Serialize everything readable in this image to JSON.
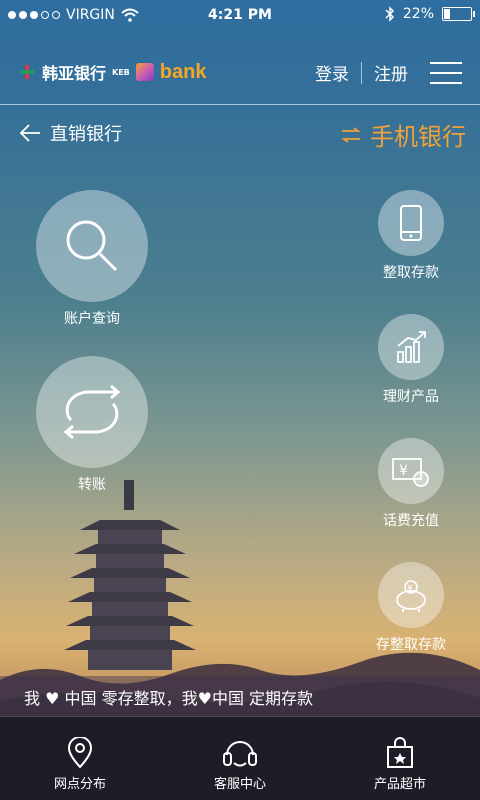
{
  "status_bar": {
    "carrier": "VIRGIN",
    "time": "4:21 PM",
    "battery": "22%"
  },
  "header": {
    "brand_cn": "韩亚银行",
    "brand_sub": "KEB",
    "brand_en": "bank",
    "login": "登录",
    "register": "注册",
    "menu_icon": "hamburger-icon"
  },
  "nav": {
    "back_label": "直销银行",
    "switch_label": "手机银行",
    "switch_color": "#f2a13a"
  },
  "actions": {
    "account_query": "账户查询",
    "transfer": "转账"
  },
  "side_actions": [
    {
      "label": "整取存款",
      "icon": "phone-icon"
    },
    {
      "label": "理财产品",
      "icon": "growth-chart-icon"
    },
    {
      "label": "话费充值",
      "icon": "bill-coin-icon"
    },
    {
      "label": "存整取存款",
      "icon": "piggy-bank-icon"
    }
  ],
  "marquee": "我 ♥ 中国 零存整取，我♥中国 定期存款",
  "tabs": [
    {
      "label": "网点分布",
      "icon": "location-pin-icon"
    },
    {
      "label": "客服中心",
      "icon": "headset-icon"
    },
    {
      "label": "产品超市",
      "icon": "shopping-bag-icon"
    }
  ]
}
